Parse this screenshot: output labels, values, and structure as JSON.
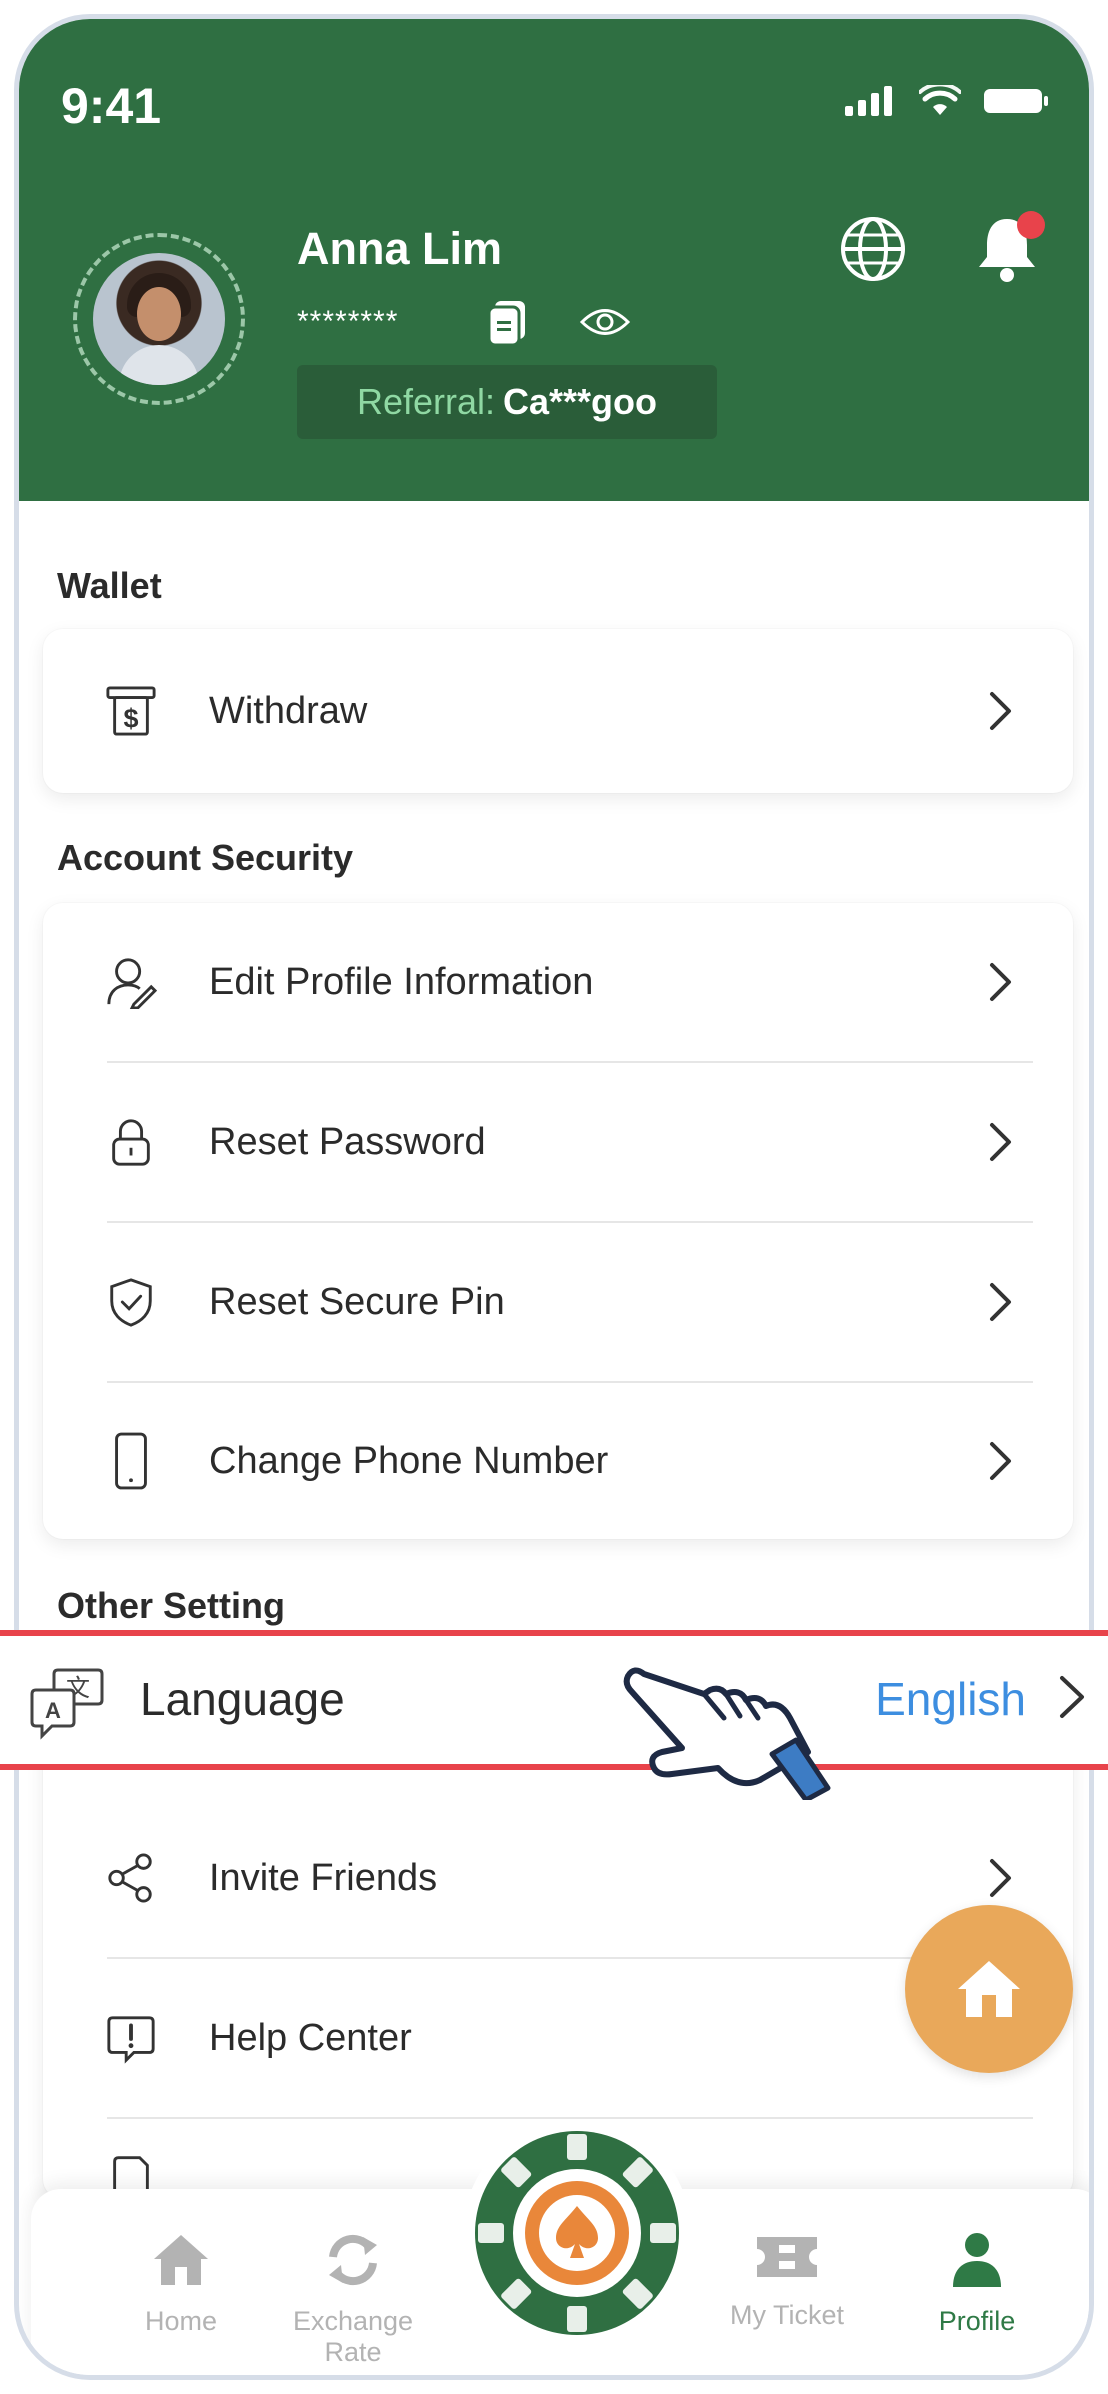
{
  "status_bar": {
    "time": "9:41"
  },
  "profile": {
    "name": "Anna Lim",
    "masked_id": "********",
    "referral_label": "Referral:",
    "referral_code": "Ca***goo"
  },
  "wallet": {
    "title": "Wallet",
    "items": [
      {
        "label": "Withdraw",
        "icon": "atm-dollar-icon"
      }
    ]
  },
  "account_security": {
    "title": "Account Security",
    "items": [
      {
        "label": "Edit Profile Information",
        "icon": "user-edit-icon"
      },
      {
        "label": "Reset Password",
        "icon": "lock-icon"
      },
      {
        "label": "Reset Secure Pin",
        "icon": "shield-check-icon"
      },
      {
        "label": "Change Phone Number",
        "icon": "phone-icon"
      }
    ]
  },
  "other_setting": {
    "title": "Other Setting",
    "language": {
      "label": "Language",
      "value": "English",
      "icon": "translate-icon"
    },
    "items": [
      {
        "label": "Invite Friends",
        "icon": "share-icon"
      },
      {
        "label": "Help Center",
        "icon": "help-icon"
      }
    ]
  },
  "bottom_nav": {
    "items": [
      {
        "label": "Home",
        "icon": "home-icon"
      },
      {
        "label": "Exchange Rate",
        "icon": "refresh-icon"
      },
      {
        "label": "My Ticket",
        "icon": "ticket-icon"
      },
      {
        "label": "Profile",
        "icon": "person-icon"
      }
    ],
    "active": "Profile"
  },
  "colors": {
    "header_green": "#2f6f42",
    "accent_blue": "#3d8ee0",
    "highlight_red": "#e8434b",
    "fab_orange": "#e9a85a",
    "active_green": "#2f7a46"
  }
}
